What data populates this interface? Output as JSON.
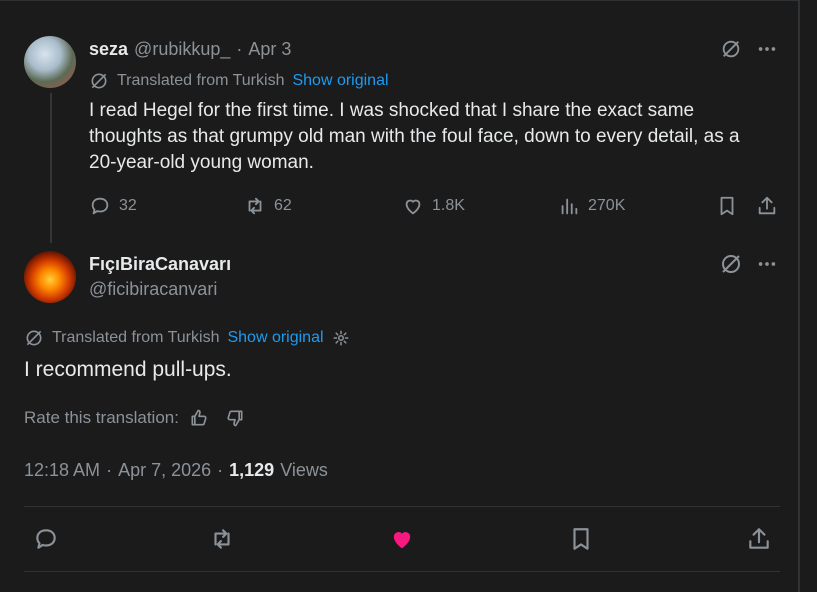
{
  "reply_tweet": {
    "display_name": "seza",
    "handle": "@rubikkup_",
    "separator": "·",
    "date": "Apr 3",
    "translated_label": "Translated from Turkish",
    "show_original": "Show original",
    "text": "I read Hegel for the first time. I was shocked that I share the exact same thoughts as that grumpy old man with the foul face, down to every detail, as a 20-year-old young woman.",
    "stats": {
      "replies": "32",
      "reposts": "62",
      "likes": "1.8K",
      "views": "270K"
    }
  },
  "main_tweet": {
    "display_name": "FıçıBiraCanavarı",
    "handle": "@ficibiracanvari",
    "translated_label": "Translated from Turkish",
    "show_original": "Show original",
    "text": "I recommend pull-ups.",
    "rate_label": "Rate this translation:",
    "time": "12:18 AM",
    "dot1": "·",
    "date": "Apr 7, 2026",
    "dot2": "·",
    "views_count": "1,129",
    "views_label": "Views"
  },
  "colors": {
    "background": "#1b1b1c",
    "text": "#e7e9ea",
    "muted": "#8b9298",
    "link": "#1d9bf0",
    "like_active": "#f91880"
  },
  "icons": [
    "grok-icon",
    "more-icon",
    "translate-icon",
    "settings-icon",
    "reply-icon",
    "repost-icon",
    "like-icon",
    "views-icon",
    "bookmark-icon",
    "share-icon",
    "thumbs-up-icon",
    "thumbs-down-icon"
  ]
}
